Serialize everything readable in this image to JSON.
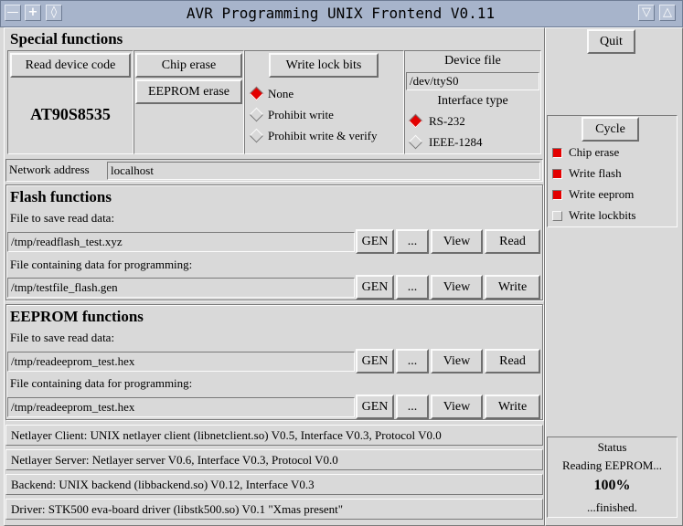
{
  "window": {
    "title": "AVR Programming UNIX Frontend V0.11",
    "controls_left": [
      "minimize-icon",
      "maximize-icon",
      "menu-icon"
    ],
    "controls_right": [
      "down-arrow-icon",
      "up-arrow-icon"
    ]
  },
  "special": {
    "heading": "Special functions",
    "read_device_code": "Read device code",
    "device_code": "AT90S8535",
    "chip_erase": "Chip erase",
    "eeprom_erase": "EEPROM erase",
    "write_lock_bits": "Write lock bits",
    "lock_options": [
      {
        "label": "None",
        "selected": true
      },
      {
        "label": "Prohibit write",
        "selected": false
      },
      {
        "label": "Prohibit write & verify",
        "selected": false
      }
    ],
    "device_file_label": "Device file",
    "device_file_value": "/dev/ttyS0",
    "interface_type_label": "Interface type",
    "interface_options": [
      {
        "label": "RS-232",
        "selected": true
      },
      {
        "label": "IEEE-1284",
        "selected": false
      }
    ]
  },
  "network": {
    "label": "Network address",
    "value": "localhost"
  },
  "flash": {
    "heading": "Flash functions",
    "read_label": "File to save read data:",
    "read_file": "/tmp/readflash_test.xyz",
    "prog_label": "File containing data for programming:",
    "prog_file": "/tmp/testfile_flash.gen",
    "gen": "GEN",
    "browse": "...",
    "view": "View",
    "read": "Read",
    "write": "Write"
  },
  "eeprom": {
    "heading": "EEPROM functions",
    "read_label": "File to save read data:",
    "read_file": "/tmp/readeeprom_test.hex",
    "prog_label": "File containing data for programming:",
    "prog_file": "/tmp/readeeprom_test.hex",
    "gen": "GEN",
    "browse": "...",
    "view": "View",
    "read": "Read",
    "write": "Write"
  },
  "info": {
    "client": "Netlayer Client:  UNIX netlayer client (libnetclient.so) V0.5, Interface V0.3, Protocol V0.0",
    "server": "Netlayer Server:  Netlayer server V0.6, Interface V0.3, Protocol V0.0",
    "backend": "Backend:  UNIX backend (libbackend.so) V0.12, Interface V0.3",
    "driver": "Driver:     STK500 eva-board driver (libstk500.so) V0.1 \"Xmas present\""
  },
  "side": {
    "quit": "Quit",
    "cycle": "Cycle",
    "cycle_options": [
      {
        "label": "Chip erase",
        "checked": true
      },
      {
        "label": "Write flash",
        "checked": true
      },
      {
        "label": "Write eeprom",
        "checked": true
      },
      {
        "label": "Write lockbits",
        "checked": false
      }
    ]
  },
  "status": {
    "heading": "Status",
    "message": "Reading EEPROM...",
    "progress": "100%",
    "result": "...finished."
  },
  "colors": {
    "titlebar": "#a7b4cb",
    "background": "#d9d9d9",
    "indicator_on": "#e30000"
  }
}
